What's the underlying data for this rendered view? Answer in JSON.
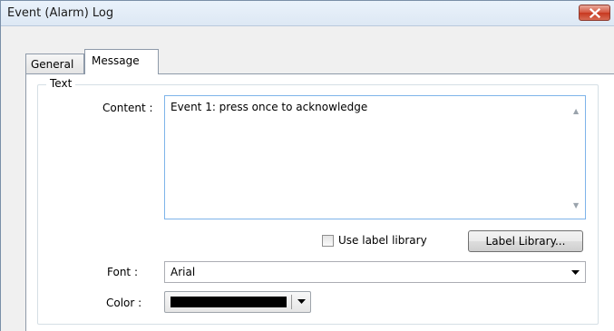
{
  "window": {
    "title": "Event (Alarm) Log"
  },
  "tabs": [
    {
      "label": "General"
    },
    {
      "label": "Message"
    }
  ],
  "text_group": {
    "title": "Text",
    "content_label": "Content :",
    "content_value": "Event 1: press once to acknowledge",
    "use_label_library_label": "Use label library",
    "use_label_library_checked": false,
    "label_library_button": "Label Library...",
    "font_label": "Font :",
    "font_value": "Arial",
    "color_label": "Color :",
    "color_value": "#000000"
  }
}
